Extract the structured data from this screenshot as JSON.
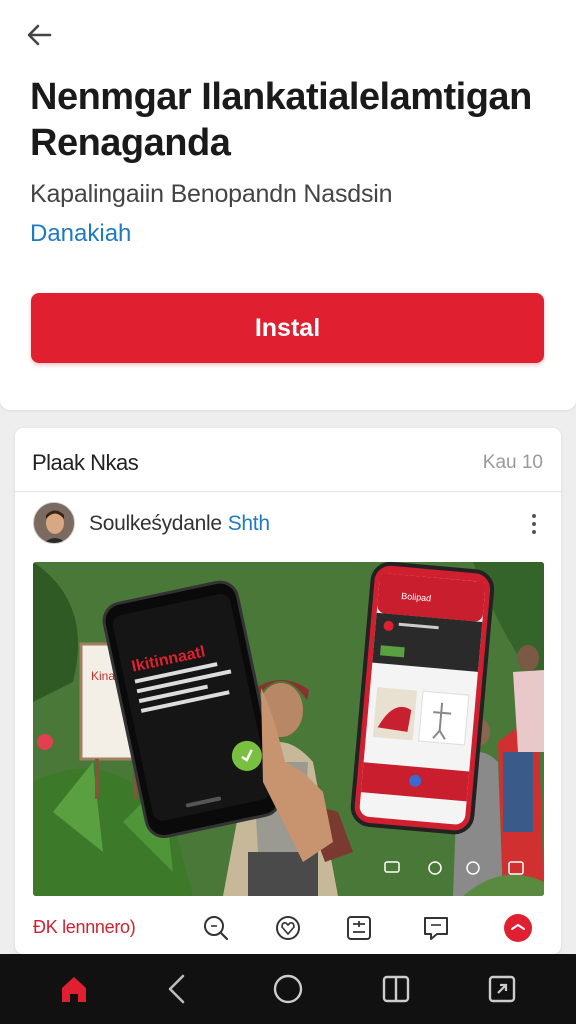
{
  "app": {
    "title": "Nenmgar Ilankatialelamtigan Renaganda",
    "subtitle": "Kapalingaiin Benopandn Nasdsin",
    "link": "Danakiah",
    "install_label": "Instal"
  },
  "feed": {
    "header_title": "Plaak Nkas",
    "header_count": "Kau 10",
    "post": {
      "author": "Soulkeśydanle",
      "author_tag": "Shth",
      "action_label": "ĐK lennnero)",
      "phone_left_text": "Ikitinnaatl",
      "phone_right_header": "Bolipad",
      "sign_text": "Kinau"
    }
  },
  "colors": {
    "accent_red": "#e02030",
    "link_blue": "#1f7ac2",
    "nav_bg": "#111111"
  },
  "icons": {
    "back": "arrow-left-icon",
    "more": "more-vertical-icon",
    "actions": [
      "search-icon",
      "heart-icon",
      "sliders-icon",
      "comment-icon",
      "red-circle-icon"
    ],
    "nav": [
      "home-icon",
      "back-chevron-icon",
      "home-circle-icon",
      "recents-icon",
      "screenshot-icon"
    ]
  }
}
